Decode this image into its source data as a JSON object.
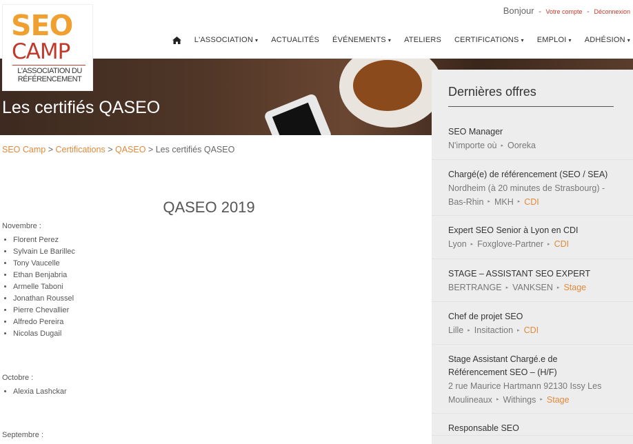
{
  "header": {
    "greeting": "Bonjour",
    "account_link": "Votre compte",
    "logout_link": "Déconnexion",
    "sep": "-"
  },
  "logo": {
    "line1": "SEO",
    "line2": "CAMP",
    "tagline": "L'ASSOCIATION DU RÉFÉRENCEMENT",
    "colors": {
      "seo": "#f0a030",
      "camp": "#c0392b"
    }
  },
  "nav": {
    "home_icon": "home-icon",
    "items": [
      {
        "label": "L'ASSOCIATION",
        "dropdown": true
      },
      {
        "label": "ACTUALITÉS",
        "dropdown": false
      },
      {
        "label": "ÉVÉNEMENTS",
        "dropdown": true
      },
      {
        "label": "ATELIERS",
        "dropdown": false
      },
      {
        "label": "CERTIFICATIONS",
        "dropdown": true
      },
      {
        "label": "EMPLOI",
        "dropdown": true
      },
      {
        "label": "ADHÉSION",
        "dropdown": true
      }
    ],
    "caret": "▾"
  },
  "banner": {
    "title": "Les certifiés QASEO"
  },
  "breadcrumb": {
    "items": [
      "SEO Camp",
      "Certifications",
      "QASEO"
    ],
    "current": "Les certifiés QASEO",
    "sep": ">"
  },
  "main": {
    "heading": "QASEO 2019",
    "months": [
      {
        "label": "Novembre :",
        "names": [
          "Florent Perez",
          "Sylvain Le Barillec",
          "Tony Vaucelle",
          "Ethan Benjabria",
          "Armelle Taboni",
          "Jonathan Roussel",
          "Pierre Chevallier",
          "Alfredo Pereira",
          "Nicolas Dugail"
        ]
      },
      {
        "label": "Octobre :",
        "names": [
          "Alexia Lashckar"
        ]
      },
      {
        "label": "Septembre :",
        "names": []
      }
    ]
  },
  "sidebar": {
    "title": "Dernières offres",
    "jobs": [
      {
        "title": "SEO Manager",
        "location": "N'importe où",
        "company": "Ooreka",
        "type": ""
      },
      {
        "title": "Chargé(e) de référencement (SEO / SEA)",
        "location": "Nordheim (à 20 minutes de Strasbourg) - Bas-Rhin",
        "company": "MKH",
        "type": "CDI"
      },
      {
        "title": "Expert SEO Senior à Lyon en CDI",
        "location": "Lyon",
        "company": "Foxglove-Partner",
        "type": "CDI"
      },
      {
        "title": "STAGE – ASSISTANT SEO EXPERT",
        "location": "BERTRANGE",
        "company": "VANKSEN",
        "type": "Stage"
      },
      {
        "title": "Chef de projet SEO",
        "location": "Lille",
        "company": "Insitaction",
        "type": "CDI"
      },
      {
        "title": "Stage Assistant Chargé.e de Référencement SEO – (H/F)",
        "location": "2 rue Maurice Hartmann 92130 Issy Les Moulineaux",
        "company": "Withings",
        "type": "Stage"
      },
      {
        "title": "Responsable SEO",
        "location": "",
        "company": "",
        "type": ""
      }
    ],
    "meta_sep": "▸"
  },
  "colors": {
    "accent": "#e08a3c",
    "sidebar_bg": "#ededed"
  }
}
